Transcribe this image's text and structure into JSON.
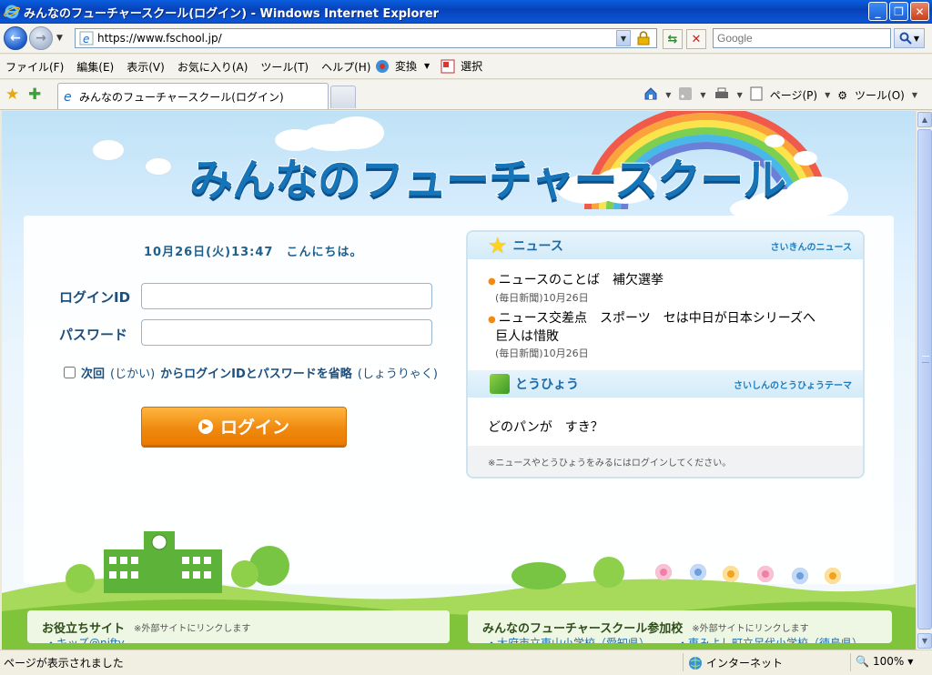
{
  "window": {
    "title": "みんなのフューチャースクール(ログイン) - Windows Internet Explorer"
  },
  "address": {
    "url": "https://www.fschool.jp/",
    "search_placeholder": "Google"
  },
  "menu": {
    "items": [
      "ファイル(F)",
      "編集(E)",
      "表示(V)",
      "お気に入り(A)",
      "ツール(T)",
      "ヘルプ(H)"
    ],
    "convert_label": "変換",
    "select_label": "選択"
  },
  "tabs": {
    "active_label": "みんなのフューチャースクール(ログイン)"
  },
  "command_bar": {
    "page_label": "ページ(P)",
    "tools_label": "ツール(O)"
  },
  "page": {
    "logo_text": "みんなのフューチャースクール",
    "date_greeting": "10月26日(火)13:47　こんにちは。",
    "login_id_label": "ログインID",
    "password_label": "パスワード",
    "remember": {
      "part1": "次回",
      "part2": "(じかい)",
      "part3": "からログインIDとパスワードを省略",
      "part4": "(しょうりゃく)"
    },
    "login_button": "ログイン",
    "news": {
      "title": "ニュース",
      "link": "さいきんのニュース",
      "items": [
        {
          "line1": "ニュースのことば　補欠選挙",
          "line2": "",
          "source": "(毎日新聞)10月26日"
        },
        {
          "line1": "ニュース交差点　スポーツ　セは中日が日本シリーズへ",
          "line2": "巨人は惜敗",
          "source": "(毎日新聞)10月26日"
        }
      ]
    },
    "poll": {
      "title": "とうひょう",
      "link": "さいしんのとうひょうテーマ",
      "question": "どのパンが　すき？"
    },
    "note": "※ニュースやとうひょうをみるにはログインしてください。",
    "bottom": {
      "left_title": "お役立ちサイト",
      "left_note": "※外部サイトにリンクします",
      "left_sub": "・キッズ@nifty",
      "right_title": "みんなのフューチャースクール参加校",
      "right_note": "※外部サイトにリンクします",
      "right_sub": "・大府市立東山小学校（愛知県）　　　・東みよし町立足代小学校（徳島県）"
    }
  },
  "status": {
    "text": "ページが表示されました",
    "zone": "インターネット",
    "zoom": "100%"
  },
  "colors": {
    "accent_blue": "#1675b9",
    "login_orange": "#f08a10",
    "title_bar": "#0a54d4"
  }
}
